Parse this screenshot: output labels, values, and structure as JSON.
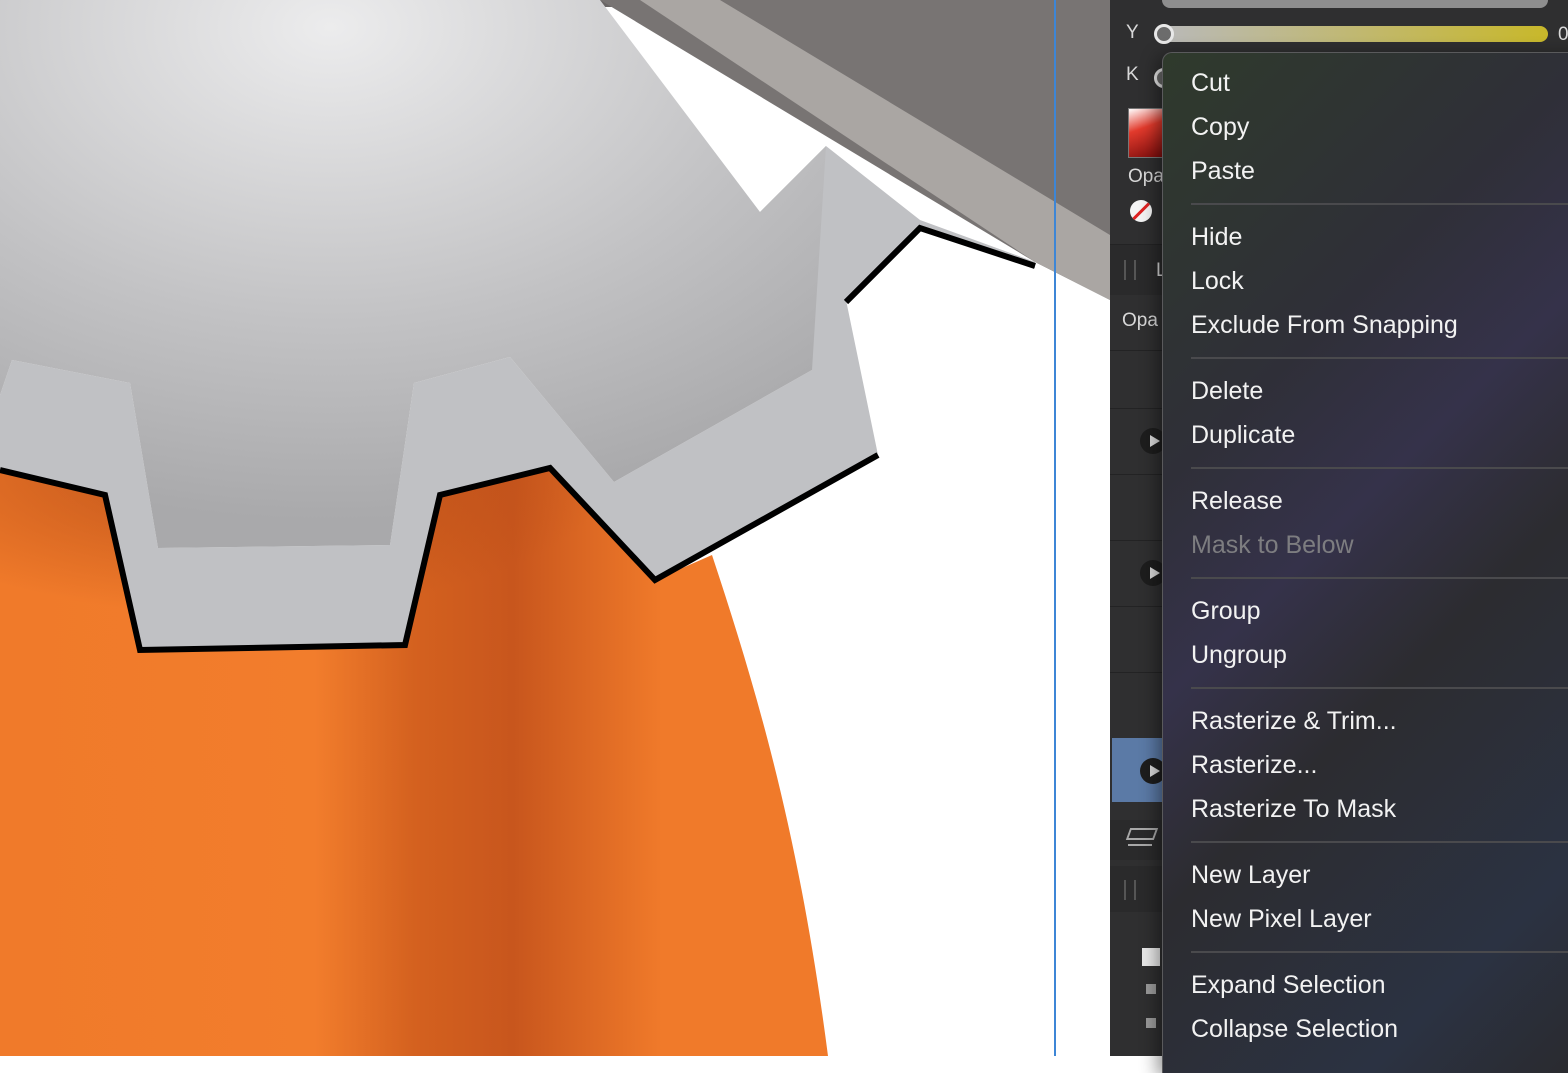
{
  "panel": {
    "label_y": "Y",
    "label_k": "K",
    "label_opacity_1": "Opa",
    "label_opacity_2": "Opa",
    "label_layers_tab": "L",
    "cmyk_value_right": "0",
    "y_slider_color": "#c8b82a",
    "fill_swatch_color": "#c41a1a",
    "selected_layer_color": "#5b7aa6"
  },
  "context_menu": {
    "cut": "Cut",
    "copy": "Copy",
    "paste": "Paste",
    "hide": "Hide",
    "lock": "Lock",
    "exclude_from_snapping": "Exclude From Snapping",
    "delete": "Delete",
    "duplicate": "Duplicate",
    "release": "Release",
    "mask_to_below": "Mask to Below",
    "group": "Group",
    "ungroup": "Ungroup",
    "rasterize_trim": "Rasterize & Trim...",
    "rasterize": "Rasterize...",
    "rasterize_to_mask": "Rasterize To Mask",
    "new_layer": "New Layer",
    "new_pixel_layer": "New Pixel Layer",
    "expand_selection": "Expand Selection",
    "collapse_selection": "Collapse Selection",
    "shortcut_cut": "⌘",
    "shortcut_copy": "⌘",
    "shortcut_paste": "⌘",
    "shortcut_group": "⌘",
    "shortcut_ungroup": "⇧⌘"
  },
  "canvas": {
    "gear_color": "#c0c1c4",
    "body_color": "#f07a2a",
    "body_shade_color": "#c9581f",
    "bar_color": "#a9a5a2"
  }
}
